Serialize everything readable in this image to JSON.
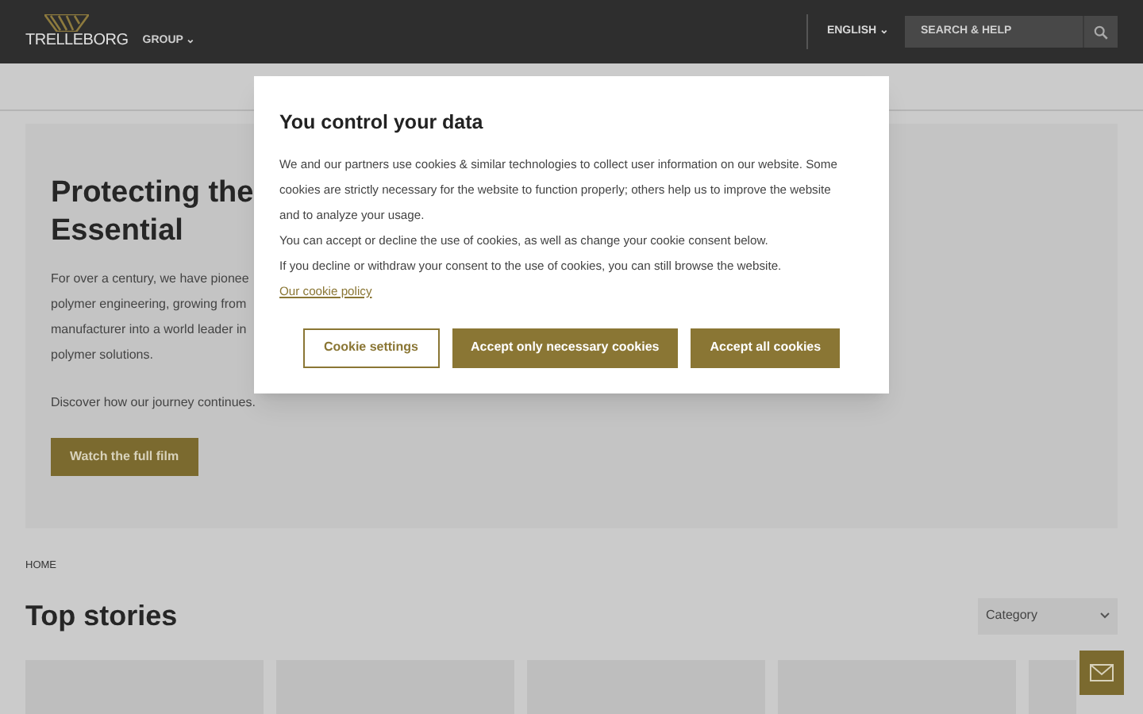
{
  "header": {
    "brand": "TRELLEBORG",
    "group_menu": "GROUP ⌄",
    "language": "ENGLISH ⌄",
    "search": {
      "placeholder": "SEARCH & HELP"
    }
  },
  "hero": {
    "title_lines": [
      "Protecting the",
      "Essential"
    ],
    "text_lines": [
      "For over a century, we have pionee",
      "polymer engineering, growing from",
      "manufacturer into a world leader in",
      "polymer solutions."
    ],
    "note": "Discover how our journey continues.",
    "button": "Watch the full film"
  },
  "breadcrumb": "HOME",
  "stories": {
    "title": "Top stories",
    "filter": "Category"
  },
  "consent": {
    "title": "You control your data",
    "paragraphs": [
      "We and our partners use cookies & similar technologies to collect user information on our website. Some cookies are strictly necessary for the website to function properly; others help us to improve the website and to analyze your usage.",
      "You can accept or decline the use of cookies, as well as change your cookie consent below."
    ],
    "last_paragraph": "If you decline or withdraw your consent to the use of cookies, you can still browse the website.",
    "policy_link": "Our cookie policy",
    "buttons": [
      {
        "label": "Cookie settings",
        "kind": "outline"
      },
      {
        "label": "Accept only necessary cookies",
        "kind": "filled"
      },
      {
        "label": "Accept all cookies",
        "kind": "filled"
      }
    ]
  }
}
